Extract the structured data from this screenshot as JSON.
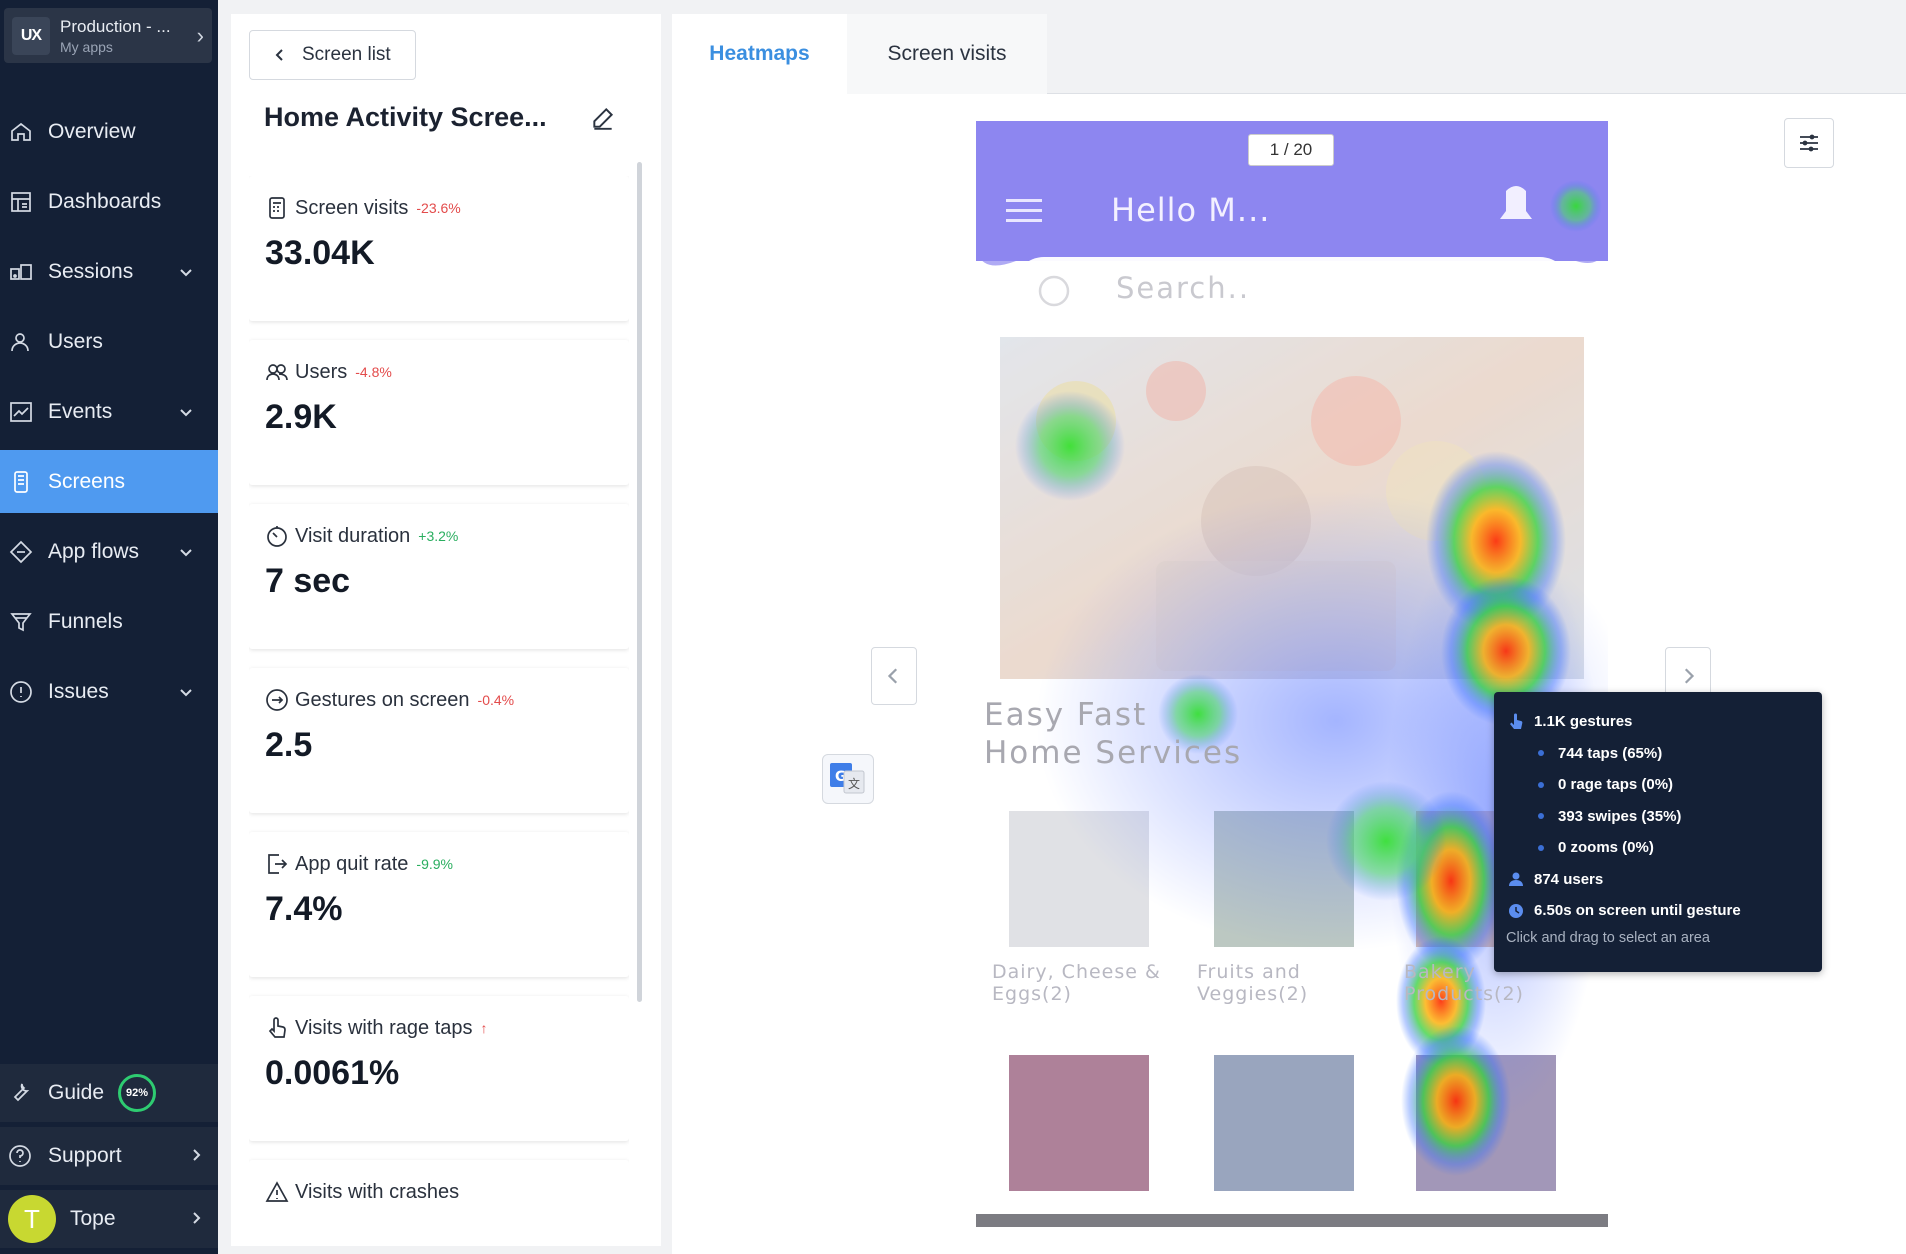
{
  "app_switcher": {
    "logo": "UX",
    "name": "Production - ...",
    "sub": "My apps"
  },
  "nav": [
    {
      "label": "Overview",
      "icon": "home-icon",
      "caret": false
    },
    {
      "label": "Dashboards",
      "icon": "dashboard-icon",
      "caret": false
    },
    {
      "label": "Sessions",
      "icon": "sessions-icon",
      "caret": true
    },
    {
      "label": "Users",
      "icon": "users-icon",
      "caret": false
    },
    {
      "label": "Events",
      "icon": "events-icon",
      "caret": true
    },
    {
      "label": "Screens",
      "icon": "screens-icon",
      "caret": false,
      "active": true
    },
    {
      "label": "App flows",
      "icon": "app-flows-icon",
      "caret": true
    },
    {
      "label": "Funnels",
      "icon": "funnel-icon",
      "caret": false
    },
    {
      "label": "Issues",
      "icon": "issues-icon",
      "caret": true
    }
  ],
  "bottom_nav": {
    "guide": {
      "label": "Guide",
      "progress": "92%"
    },
    "support": {
      "label": "Support"
    },
    "user": {
      "initial": "T",
      "name": "Tope"
    }
  },
  "panel": {
    "back_label": "Screen list",
    "screen_title": "Home Activity Scree..."
  },
  "metrics": [
    {
      "label": "Screen visits",
      "delta": "-23.6%",
      "trend": "neg",
      "value": "33.04K",
      "icon": "screen-visits-icon"
    },
    {
      "label": "Users",
      "delta": "-4.8%",
      "trend": "neg",
      "value": "2.9K",
      "icon": "users-icon"
    },
    {
      "label": "Visit duration",
      "delta": "+3.2%",
      "trend": "pos",
      "value": "7 sec",
      "icon": "timer-icon"
    },
    {
      "label": "Gestures on screen",
      "delta": "-0.4%",
      "trend": "neg",
      "value": "2.5",
      "icon": "gesture-icon"
    },
    {
      "label": "App quit rate",
      "delta": "-9.9%",
      "trend": "pos",
      "value": "7.4%",
      "icon": "exit-icon"
    },
    {
      "label": "Visits with rage taps",
      "delta": "↑",
      "trend": "neg",
      "value": "0.0061%",
      "icon": "rage-tap-icon"
    },
    {
      "label": "Visits with crashes",
      "delta": "",
      "trend": "neg",
      "value": "",
      "icon": "warning-icon"
    }
  ],
  "tabs": {
    "heatmaps": "Heatmaps",
    "screen_visits": "Screen visits"
  },
  "phone": {
    "pager": "1 / 20",
    "greeting": "Hello M...",
    "search_placeholder": "Search..",
    "heading_line1": "Easy Fast",
    "heading_line2": "Home Services",
    "categories": [
      {
        "line1": "Dairy, Cheese &",
        "line2": "Eggs(2)"
      },
      {
        "line1": "Fruits and",
        "line2": "Veggies(2)"
      },
      {
        "line1": "Bakery",
        "line2": "Products(2)"
      }
    ]
  },
  "tooltip": {
    "gestures": "1.1K gestures",
    "taps": "744 taps (65%)",
    "rage_taps": "0 rage taps (0%)",
    "swipes": "393 swipes (35%)",
    "zooms": "0 zooms (0%)",
    "users": "874 users",
    "time": "6.50s on screen until gesture",
    "hint": "Click and drag to select an area"
  },
  "colors": {
    "sidebar": "#142036",
    "active": "#4f9af0",
    "accent_tab": "#3b8fe0",
    "negative": "#e34b4b",
    "positive": "#2aae5f",
    "phone_header": "#8a7ff0"
  }
}
